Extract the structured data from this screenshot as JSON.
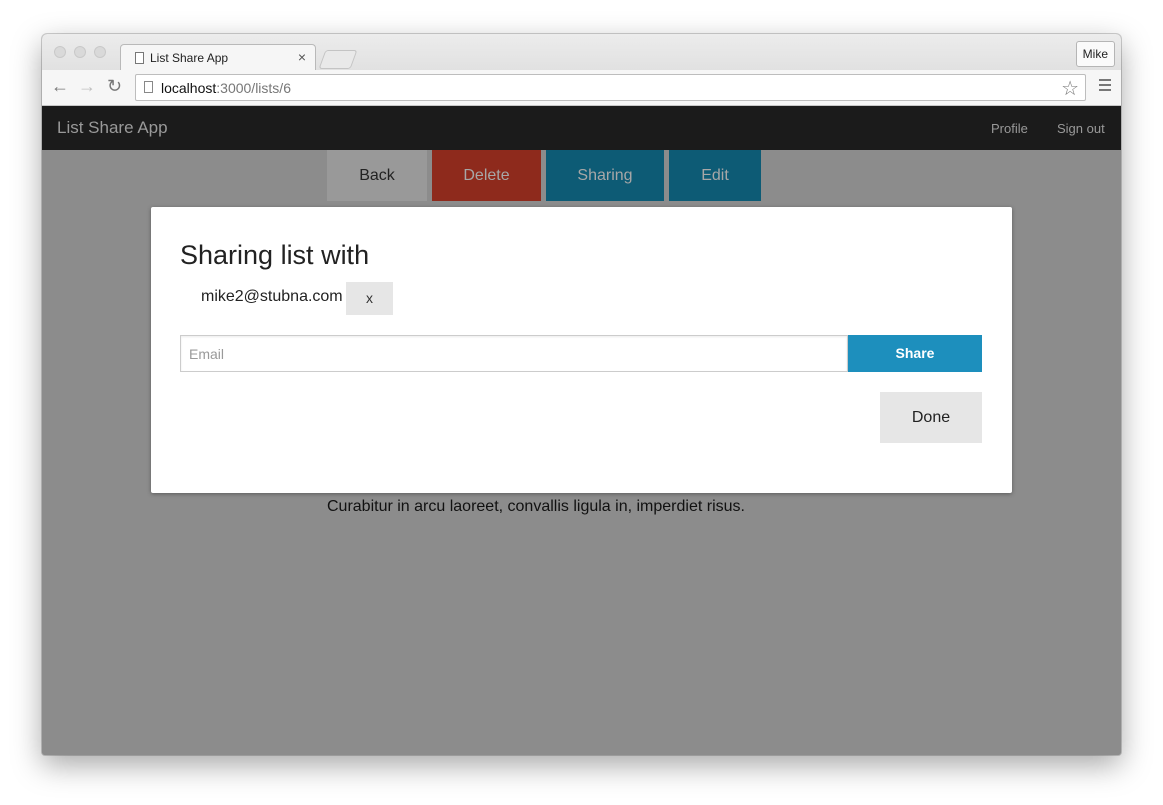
{
  "browser": {
    "tab_title": "List Share App",
    "tab_close": "×",
    "profile_name": "Mike",
    "url_host": "localhost",
    "url_path": ":3000/lists/6",
    "icons": [
      "back-arrow-icon",
      "forward-arrow-icon",
      "reload-icon",
      "page-icon",
      "bookmark-star-icon",
      "menu-icon"
    ]
  },
  "navbar": {
    "brand": "List Share App",
    "links": [
      "Profile",
      "Sign out"
    ]
  },
  "actions": {
    "back": "Back",
    "delete": "Delete",
    "sharing": "Sharing",
    "edit": "Edit"
  },
  "page": {
    "body_text": "Curabitur in arcu laoreet, convallis ligula in, imperdiet risus."
  },
  "modal": {
    "title": "Sharing list with",
    "shared_users": [
      {
        "email": "mike2@stubna.com",
        "remove_label": "x"
      }
    ],
    "email_placeholder": "Email",
    "share_label": "Share",
    "done_label": "Done"
  },
  "colors": {
    "navbar_bg": "#1b1b1b",
    "overlay_bg": "#8c8c8c",
    "back_btn": "#999999",
    "delete_btn": "#8e2a1c",
    "sharing_btn": "#0d5b75",
    "edit_btn": "#0d5b75",
    "share_btn": "#1d8fbd"
  }
}
